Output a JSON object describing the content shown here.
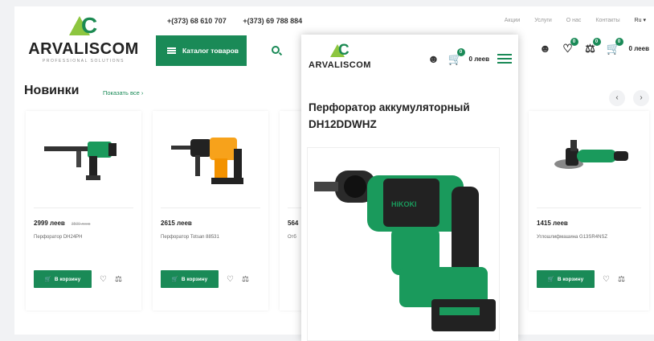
{
  "logo": {
    "text": "ARVALISCOM",
    "sub": "PROFESSIONAL SOLUTIONS"
  },
  "header": {
    "phones": [
      "+(373) 68 610 707",
      "+(373) 69 788 884"
    ],
    "links": [
      "Акции",
      "Услуги",
      "О нас",
      "Контакты",
      "Ru ▾"
    ],
    "catalog_label": "Каталог товаров",
    "compare_count": "0",
    "wish_count": "0",
    "cart_count": "0",
    "cart_total": "0 леев"
  },
  "section": {
    "title": "Новинки",
    "show_all": "Показать все  ›"
  },
  "products": [
    {
      "price": "2999 леев",
      "old_price": "3500 леев",
      "name": "Перфоратор DH24PH"
    },
    {
      "price": "2615 леев",
      "old_price": "",
      "name": "Перфоратор Totsan 88531"
    },
    {
      "price": "564",
      "old_price": "",
      "name": "Отб"
    },
    {
      "price": "1415 леев",
      "old_price": "",
      "name": "Углошлифмашина G13SR4NSZ"
    }
  ],
  "cart_button": "В корзину",
  "popup": {
    "logo_text": "ARVALISCOM",
    "cart_count": "0",
    "cart_total": "0 леев",
    "title": "Перфоратор  аккумуляторный DH12DDWHZ",
    "brand_on_tool": "HiKOKI"
  },
  "colors": {
    "accent": "#1a8a57",
    "logo_green": "#8dc63f"
  }
}
